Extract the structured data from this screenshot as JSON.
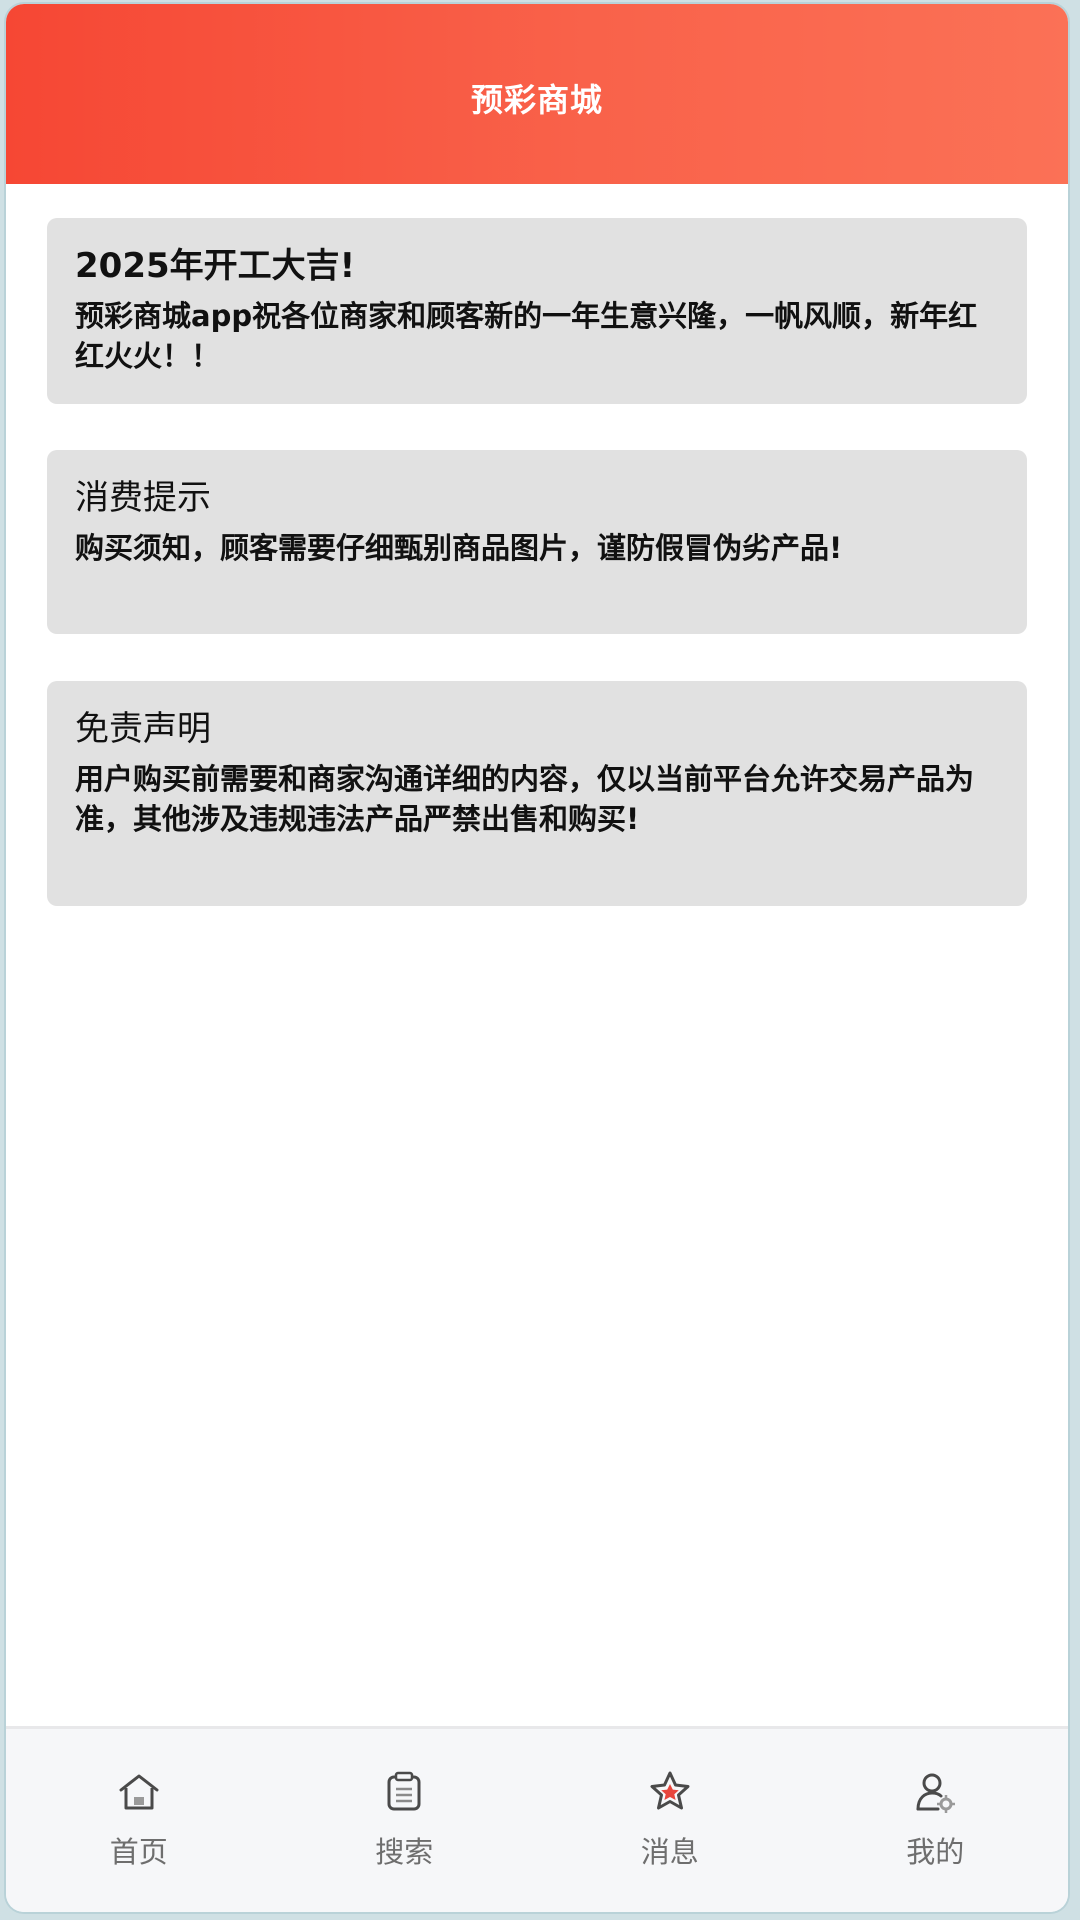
{
  "header": {
    "title": "预彩商城"
  },
  "notices": [
    {
      "title": "2025年开工大吉!",
      "body": "预彩商城app祝各位商家和顾客新的一年生意兴隆，一帆风顺，新年红红火火！！"
    },
    {
      "title": "消费提示",
      "body": "购买须知，顾客需要仔细甄别商品图片，谨防假冒伪劣产品!"
    },
    {
      "title": "免责声明",
      "body": "用户购买前需要和商家沟通详细的内容，仅以当前平台允许交易产品为准，其他涉及违规违法产品严禁出售和购买!"
    }
  ],
  "tabs": [
    {
      "label": "首页",
      "icon": "home-icon"
    },
    {
      "label": "搜索",
      "icon": "list-icon"
    },
    {
      "label": "消息",
      "icon": "star-icon"
    },
    {
      "label": "我的",
      "icon": "user-settings-icon"
    }
  ],
  "colors": {
    "header_gradient_start": "#f64734",
    "header_gradient_end": "#fb7156",
    "card_background": "#e1e1e1",
    "tab_label": "#6e6e6e",
    "star_accent": "#e8453c"
  }
}
